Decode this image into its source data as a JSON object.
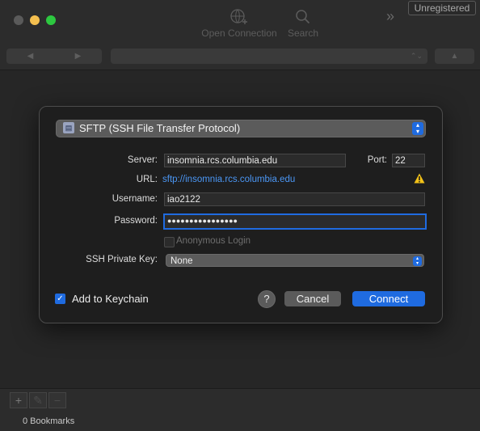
{
  "toolbar": {
    "open_connection": "Open Connection",
    "search": "Search",
    "unregistered": "Unregistered"
  },
  "navbar": {
    "back_icon": "back-arrow-icon",
    "forward_icon": "forward-arrow-icon",
    "up_icon": "up-arrow-icon"
  },
  "dialog": {
    "protocol": "SFTP (SSH File Transfer Protocol)",
    "server_label": "Server:",
    "server_value": "insomnia.rcs.columbia.edu",
    "port_label": "Port:",
    "port_value": "22",
    "url_label": "URL:",
    "url_value": "sftp://insomnia.rcs.columbia.edu",
    "username_label": "Username:",
    "username_value": "iao2122",
    "password_label": "Password:",
    "password_value": "●●●●●●●●●●●●●●●●",
    "anonymous_label": "Anonymous Login",
    "anonymous_checked": false,
    "ssh_key_label": "SSH Private Key:",
    "ssh_key_value": "None",
    "keychain_label": "Add to Keychain",
    "keychain_checked": true,
    "help_label": "?",
    "cancel_label": "Cancel",
    "connect_label": "Connect"
  },
  "bottom": {
    "add_label": "+",
    "remove_label": "−",
    "bookmarks": "0 Bookmarks"
  },
  "colors": {
    "accent": "#1f6be0",
    "link": "#4b97f5",
    "warning": "#f2c118"
  }
}
